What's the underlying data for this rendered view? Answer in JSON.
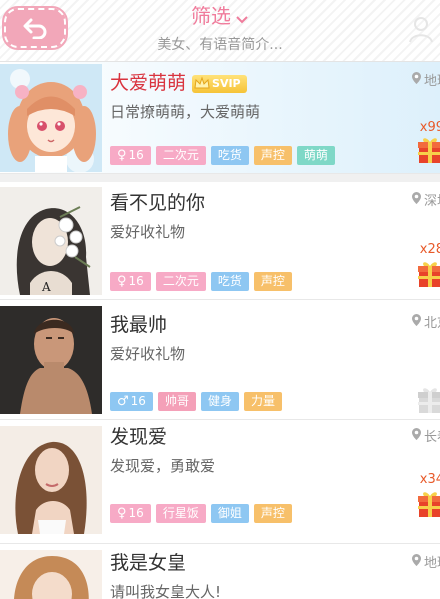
{
  "header": {
    "title": "筛选",
    "subtitle": "美女、有语音简介..."
  },
  "colors": {
    "pink": "#f7aac6",
    "blue": "#8ec7f2",
    "orange": "#f7c06a",
    "teal": "#7fd8c7",
    "rose": "#f4a0b8"
  },
  "users": [
    {
      "name": "大爱萌萌",
      "svip": "SVIP",
      "signature": "日常撩萌萌，大爱萌萌",
      "location": "地球",
      "gift_count": "x99",
      "tags": [
        {
          "label": "16",
          "sex": "♀",
          "color": "#f7aac6"
        },
        {
          "label": "二次元",
          "color": "#f7aac6"
        },
        {
          "label": "吃货",
          "color": "#8ec7f2"
        },
        {
          "label": "声控",
          "color": "#f7c06a"
        },
        {
          "label": "萌萌",
          "color": "#7fd8c7"
        }
      ]
    },
    {
      "name": "看不见的你",
      "signature": "爱好收礼物",
      "location": "深圳",
      "gift_count": "x28",
      "tags": [
        {
          "label": "16",
          "sex": "♀",
          "color": "#f7aac6"
        },
        {
          "label": "二次元",
          "color": "#f7aac6"
        },
        {
          "label": "吃货",
          "color": "#8ec7f2"
        },
        {
          "label": "声控",
          "color": "#f7c06a"
        }
      ]
    },
    {
      "name": "我最帅",
      "signature": "爱好收礼物",
      "location": "北京",
      "gift_count": "",
      "tags": [
        {
          "label": "16",
          "sex": "♂",
          "color": "#8ec7f2"
        },
        {
          "label": "帅哥",
          "color": "#f4a0b8"
        },
        {
          "label": "健身",
          "color": "#8ec7f2"
        },
        {
          "label": "力量",
          "color": "#f7c06a"
        }
      ]
    },
    {
      "name": "发现爱",
      "signature": "发现爱，勇敢爱",
      "location": "长春",
      "gift_count": "x34",
      "tags": [
        {
          "label": "16",
          "sex": "♀",
          "color": "#f7aac6"
        },
        {
          "label": "行星饭",
          "color": "#f7aac6"
        },
        {
          "label": "御姐",
          "color": "#8ec7f2"
        },
        {
          "label": "声控",
          "color": "#f7c06a"
        }
      ]
    },
    {
      "name": "我是女皇",
      "signature": "请叫我女皇大人!",
      "location": "地球",
      "gift_count": "",
      "tags": []
    }
  ]
}
